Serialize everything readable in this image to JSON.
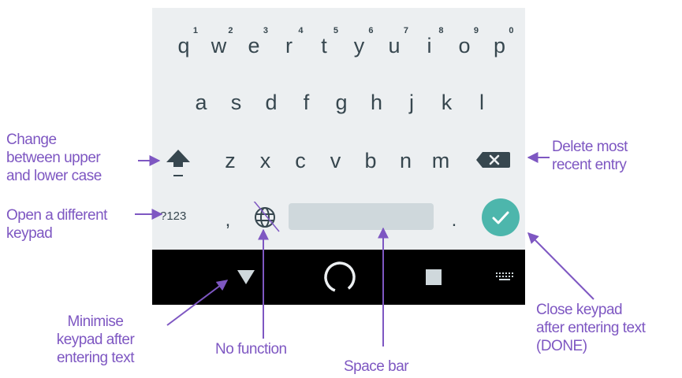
{
  "keyboard": {
    "row1": [
      {
        "letter": "q",
        "hint": "1"
      },
      {
        "letter": "w",
        "hint": "2"
      },
      {
        "letter": "e",
        "hint": "3"
      },
      {
        "letter": "r",
        "hint": "4"
      },
      {
        "letter": "t",
        "hint": "5"
      },
      {
        "letter": "y",
        "hint": "6"
      },
      {
        "letter": "u",
        "hint": "7"
      },
      {
        "letter": "i",
        "hint": "8"
      },
      {
        "letter": "o",
        "hint": "9"
      },
      {
        "letter": "p",
        "hint": "0"
      }
    ],
    "row2": [
      "a",
      "s",
      "d",
      "f",
      "g",
      "h",
      "j",
      "k",
      "l"
    ],
    "row3": [
      "z",
      "x",
      "c",
      "v",
      "b",
      "n",
      "m"
    ],
    "symbols_label": "?123",
    "comma": ",",
    "period": ".",
    "icons": {
      "shift": "shift-arrow-icon",
      "delete": "backspace-icon",
      "globe": "globe-icon",
      "done": "checkmark-icon"
    },
    "colors": {
      "background": "#eceff1",
      "key_text": "#37474f",
      "done_button": "#4db6ac",
      "space_bar": "#cfd8dc"
    }
  },
  "navbar": {
    "icons": [
      "back-triangle-icon",
      "home-circle-icon",
      "recents-square-icon",
      "keyboard-switch-icon"
    ],
    "background": "#000000"
  },
  "annotations": {
    "change_case": "Change\nbetween upper\nand lower case",
    "open_keypad": "Open a different\nkeypad",
    "delete": "Delete most\nrecent entry",
    "minimise": "Minimise\nkeypad after\nentering text",
    "no_function": "No function",
    "space_bar": "Space bar",
    "close_keypad": "Close keypad\nafter entering text\n(DONE)",
    "color": "#7e57c2"
  }
}
